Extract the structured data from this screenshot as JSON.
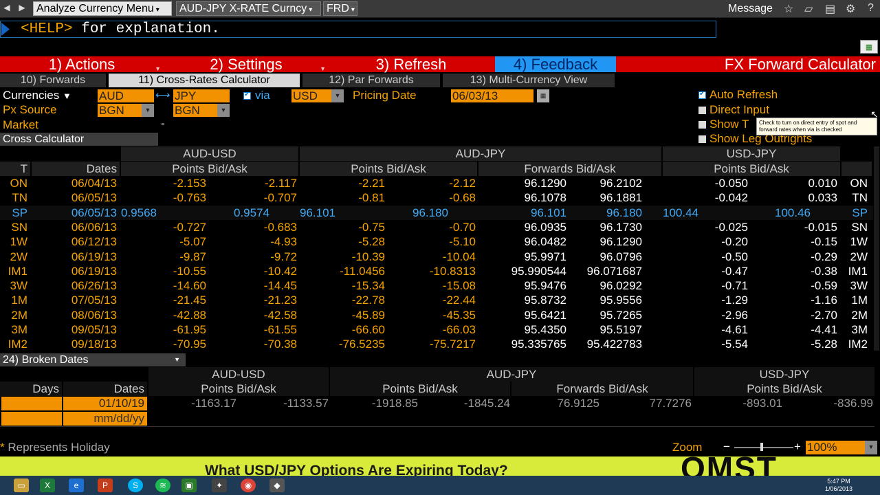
{
  "toolbar": {
    "currency_menu": "Analyze Currency Menu",
    "rate_menu": "AUD-JPY X-RATE Curncy",
    "frd_menu": "FRD",
    "message": "Message"
  },
  "command": {
    "help": "<HELP>",
    "rest": " for explanation."
  },
  "menu": {
    "actions": "1) Actions",
    "settings": "2) Settings",
    "refresh": "3) Refresh",
    "feedback": "4) Feedback",
    "title": "FX Forward Calculator"
  },
  "tabs": [
    "10) Forwards",
    "11) Cross-Rates Calculator",
    "12) Par Forwards",
    "13) Multi-Currency View"
  ],
  "controls": {
    "currencies_label": "Currencies",
    "base": "AUD",
    "quote": "JPY",
    "via_label": "via",
    "via_ccy": "USD",
    "pricing_label": "Pricing Date",
    "pricing_date": "06/03/13",
    "px_source_label": "Px Source",
    "px1": "BGN",
    "px2": "BGN",
    "market_label": "Market",
    "market_value": "-",
    "auto_refresh": "Auto Refresh",
    "direct_input": "Direct Input",
    "show_t": "Show T",
    "show_leg": "Show Leg Outrights",
    "tooltip": "Check to turn on direct entry of spot and forward rates when via is checked"
  },
  "cross": {
    "section": "Cross Calculator",
    "g_audusd": "AUD-USD",
    "g_audjpy": "AUD-JPY",
    "g_usdjpy": "USD-JPY",
    "h_t": "T",
    "h_dates": "Dates",
    "h_pts1": "Points Bid/Ask",
    "h_pts2": "Points Bid/Ask",
    "h_fwd": "Forwards Bid/Ask",
    "h_pts3": "Points Bid/Ask",
    "rows": [
      {
        "t": "ON",
        "d": "06/04/13",
        "a1": "-2.153",
        "a2": "-2.117",
        "b1": "-2.21",
        "b2": "-2.12",
        "c1": "96.1290",
        "c2": "96.2102",
        "e1": "-0.050",
        "e2": "0.010"
      },
      {
        "t": "TN",
        "d": "06/05/13",
        "a1": "-0.763",
        "a2": "-0.707",
        "b1": "-0.81",
        "b2": "-0.68",
        "c1": "96.1078",
        "c2": "96.1881",
        "e1": "-0.042",
        "e2": "0.033"
      },
      {
        "t": "SP",
        "d": "06/05/13",
        "a1": "0.9568",
        "a2": "0.9574",
        "b1": "96.101",
        "b2": "96.180",
        "c1": "96.101",
        "c2": "96.180",
        "e1": "100.44",
        "e2": "100.46"
      },
      {
        "t": "SN",
        "d": "06/06/13",
        "a1": "-0.727",
        "a2": "-0.683",
        "b1": "-0.75",
        "b2": "-0.70",
        "c1": "96.0935",
        "c2": "96.1730",
        "e1": "-0.025",
        "e2": "-0.015"
      },
      {
        "t": "1W",
        "d": "06/12/13",
        "a1": "-5.07",
        "a2": "-4.93",
        "b1": "-5.28",
        "b2": "-5.10",
        "c1": "96.0482",
        "c2": "96.1290",
        "e1": "-0.20",
        "e2": "-0.15"
      },
      {
        "t": "2W",
        "d": "06/19/13",
        "a1": "-9.87",
        "a2": "-9.72",
        "b1": "-10.39",
        "b2": "-10.04",
        "c1": "95.9971",
        "c2": "96.0796",
        "e1": "-0.50",
        "e2": "-0.29"
      },
      {
        "t": "IM1",
        "d": "06/19/13",
        "a1": "-10.55",
        "a2": "-10.42",
        "b1": "-11.0456",
        "b2": "-10.8313",
        "c1": "95.990544",
        "c2": "96.071687",
        "e1": "-0.47",
        "e2": "-0.38"
      },
      {
        "t": "3W",
        "d": "06/26/13",
        "a1": "-14.60",
        "a2": "-14.45",
        "b1": "-15.34",
        "b2": "-15.08",
        "c1": "95.9476",
        "c2": "96.0292",
        "e1": "-0.71",
        "e2": "-0.59"
      },
      {
        "t": "1M",
        "d": "07/05/13",
        "a1": "-21.45",
        "a2": "-21.23",
        "b1": "-22.78",
        "b2": "-22.44",
        "c1": "95.8732",
        "c2": "95.9556",
        "e1": "-1.29",
        "e2": "-1.16"
      },
      {
        "t": "2M",
        "d": "08/06/13",
        "a1": "-42.88",
        "a2": "-42.58",
        "b1": "-45.89",
        "b2": "-45.35",
        "c1": "95.6421",
        "c2": "95.7265",
        "e1": "-2.96",
        "e2": "-2.70"
      },
      {
        "t": "3M",
        "d": "09/05/13",
        "a1": "-61.95",
        "a2": "-61.55",
        "b1": "-66.60",
        "b2": "-66.03",
        "c1": "95.4350",
        "c2": "95.5197",
        "e1": "-4.61",
        "e2": "-4.41"
      },
      {
        "t": "IM2",
        "d": "09/18/13",
        "a1": "-70.95",
        "a2": "-70.38",
        "b1": "-76.5235",
        "b2": "-75.7217",
        "c1": "95.335765",
        "c2": "95.422783",
        "e1": "-5.54",
        "e2": "-5.28"
      }
    ]
  },
  "broken": {
    "section": "24) Broken Dates",
    "g_audusd": "AUD-USD",
    "g_audjpy": "AUD-JPY",
    "g_usdjpy": "USD-JPY",
    "h_days": "Days",
    "h_dates": "Dates",
    "h_pts1": "Points Bid/Ask",
    "h_pts2": "Points Bid/Ask",
    "h_fwd": "Forwards Bid/Ask",
    "h_pts3": "Points Bid/Ask",
    "row": {
      "date": "01/10/19",
      "a1": "-1163.17",
      "a2": "-1133.57",
      "b1": "-1918.85",
      "b2": "-1845.24",
      "c1": "76.9125",
      "c2": "77.7276",
      "e1": "-893.01",
      "e2": "-836.99"
    },
    "placeholder": "mm/dd/yy"
  },
  "footer": {
    "holiday_mark": "*",
    "holiday": "Represents Holiday",
    "zoom": "Zoom",
    "zoom_value": "100%"
  },
  "banner": {
    "text": "What USD/JPY Options Are Expiring Today?",
    "logo": "OMST"
  },
  "clock": {
    "time": "5:47 PM",
    "date": "1/06/2013"
  }
}
